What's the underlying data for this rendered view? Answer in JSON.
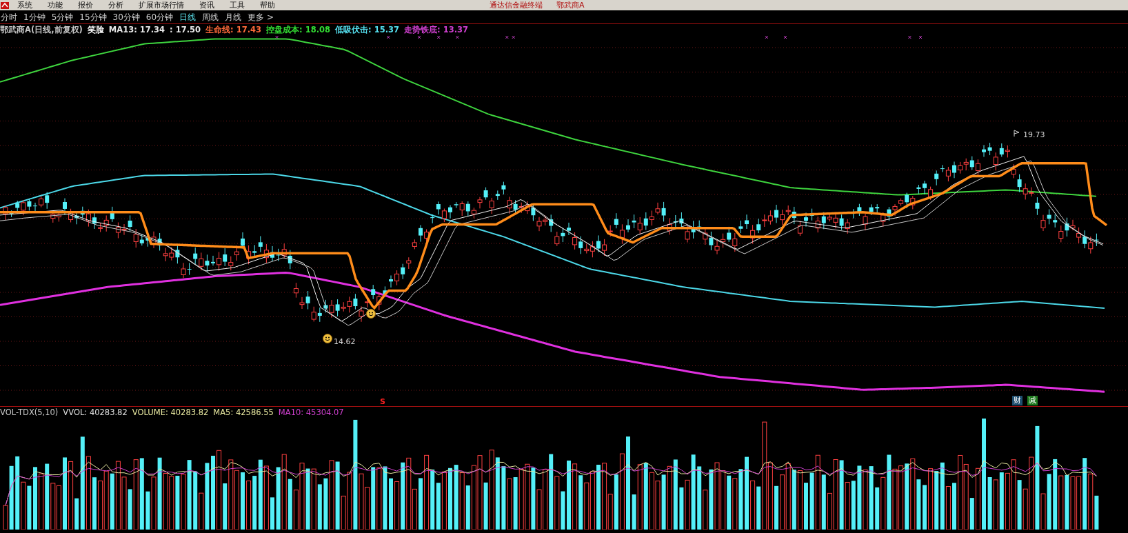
{
  "menu_bar": {
    "items": [
      "系统",
      "功能",
      "报价",
      "分析",
      "扩展市场行情",
      "资讯",
      "工具",
      "帮助"
    ],
    "app_title": "通达信金融终端",
    "security_title": "鄂武商A"
  },
  "periods": [
    {
      "label": "分时",
      "selected": false
    },
    {
      "label": "1分钟",
      "selected": false
    },
    {
      "label": "5分钟",
      "selected": false
    },
    {
      "label": "15分钟",
      "selected": false
    },
    {
      "label": "30分钟",
      "selected": false
    },
    {
      "label": "60分钟",
      "selected": false
    },
    {
      "label": "日线",
      "selected": true
    },
    {
      "label": "周线",
      "selected": false
    },
    {
      "label": "月线",
      "selected": false
    },
    {
      "label": "更多 >",
      "selected": false
    }
  ],
  "main_chart": {
    "info": [
      {
        "text": "鄂武商A(日线,前复权)",
        "color": "#c8c8c8"
      },
      {
        "text": "笑脸",
        "color": "#ffffff"
      },
      {
        "text": "MA13: 17.34",
        "color": "#e8e8e8"
      },
      {
        "text": ": 17.50",
        "color": "#e8e8e8"
      },
      {
        "text": "生命线: 17.43",
        "color": "#ff6a3a"
      },
      {
        "text": "控盘成本: 18.08",
        "color": "#33dd33"
      },
      {
        "text": "低吸伏击: 15.37",
        "color": "#55e0f0"
      },
      {
        "text": "走势铁底: 13.37",
        "color": "#d040d0"
      }
    ],
    "high_label": "19.73",
    "low_label": "14.62",
    "signal_label": "S",
    "tags": [
      {
        "text": "财",
        "color": "#1f4f6f"
      },
      {
        "text": "减",
        "color": "#1f7a1f"
      }
    ]
  },
  "volume_chart": {
    "info": [
      {
        "text": "VOL-TDX(5,10)",
        "color": "#c8c8c8"
      },
      {
        "text": "VVOL: 40283.82",
        "color": "#e0e0e0"
      },
      {
        "text": "VOLUME: 40283.82",
        "color": "#e8e8a0"
      },
      {
        "text": "MA5: 42586.55",
        "color": "#e8e8a0"
      },
      {
        "text": "MA10: 45304.07",
        "color": "#d040d0"
      }
    ]
  }
}
